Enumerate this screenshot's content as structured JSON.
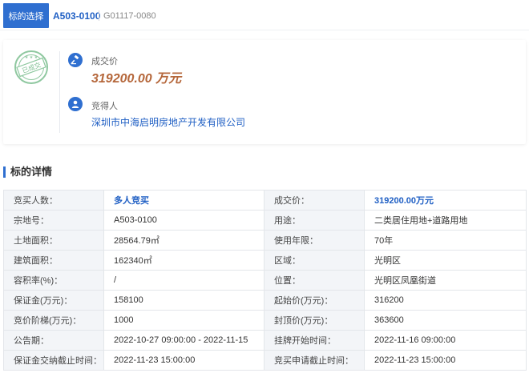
{
  "header": {
    "selector_label": "标的选择",
    "lot_code": "A503-0100",
    "lot_sub": "G01117-0080"
  },
  "result": {
    "stamp_text": "已成交",
    "deal_label": "成交价",
    "deal_price": "319200.00 万元",
    "winner_label": "竞得人",
    "winner_name": "深圳市中海启明房地产开发有限公司",
    "accent_color": "#2f6fd0",
    "price_color": "#b5673b"
  },
  "details": {
    "title": "标的详情",
    "rows": [
      {
        "k1": "竞买人数：",
        "v1": "多人竞买",
        "k2": "成交价：",
        "v2": "319200.00万元"
      },
      {
        "k1": "宗地号：",
        "v1": "A503-0100",
        "k2": "用途：",
        "v2": "二类居住用地+道路用地"
      },
      {
        "k1": "土地面积：",
        "v1": "28564.79㎡",
        "k2": "使用年限：",
        "v2": "70年"
      },
      {
        "k1": "建筑面积：",
        "v1": "162340㎡",
        "k2": "区域：",
        "v2": "光明区"
      },
      {
        "k1": "容积率(%)：",
        "v1": "/",
        "k2": "位置：",
        "v2": "光明区凤凰街道"
      },
      {
        "k1": "保证金(万元)：",
        "v1": "158100",
        "k2": "起始价(万元)：",
        "v2": "316200"
      },
      {
        "k1": "竞价阶梯(万元)：",
        "v1": "1000",
        "k2": "封顶价(万元)：",
        "v2": "363600"
      },
      {
        "k1": "公告期：",
        "v1": "2022-10-27 09:00:00 - 2022-11-15",
        "k2": "挂牌开始时间：",
        "v2": "2022-11-16 09:00:00"
      },
      {
        "k1": "保证金交纳截止时间：",
        "v1": "2022-11-23 15:00:00",
        "k2": "竞买申请截止时间：",
        "v2": "2022-11-23 15:00:00"
      }
    ]
  }
}
